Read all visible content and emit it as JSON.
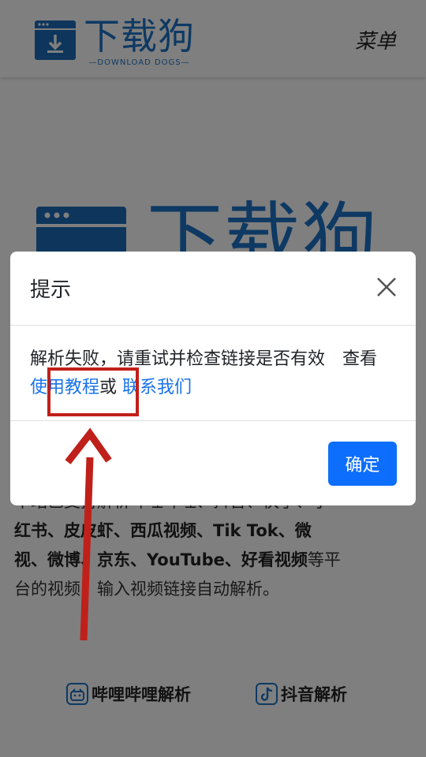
{
  "header": {
    "logo_cn": "下载狗",
    "logo_en": "—DOWNLOAD DOGS—",
    "menu_label": "菜单"
  },
  "hero": {
    "logo_cn": "下载狗"
  },
  "description": {
    "line1": "本站已支持解析哔哩哔哩、抖音、快手、小",
    "line2": "红书、皮皮虾、西瓜视频、Tik Tok、微",
    "line3_bold": "视、微博、京东、YouTube、好看视频",
    "line3_rest": "等平",
    "line4": "台的视频，输入视频链接自动解析。"
  },
  "quick_links": [
    {
      "label": "哔哩哔哩解析",
      "icon": "bilibili-icon"
    },
    {
      "label": "抖音解析",
      "icon": "douyin-icon"
    }
  ],
  "modal": {
    "title": "提示",
    "message": "解析失败，请重试并检查链接是否有效　查看",
    "tutorial_link": "使用教程",
    "or_text": "或",
    "contact_link": "联系我们",
    "confirm_label": "确定",
    "close_icon": "close-icon"
  },
  "colors": {
    "brand_blue": "#1c73c7",
    "link_blue": "#1a73e8",
    "primary_button": "#0d6efd",
    "annotation_red": "#c0201a"
  }
}
